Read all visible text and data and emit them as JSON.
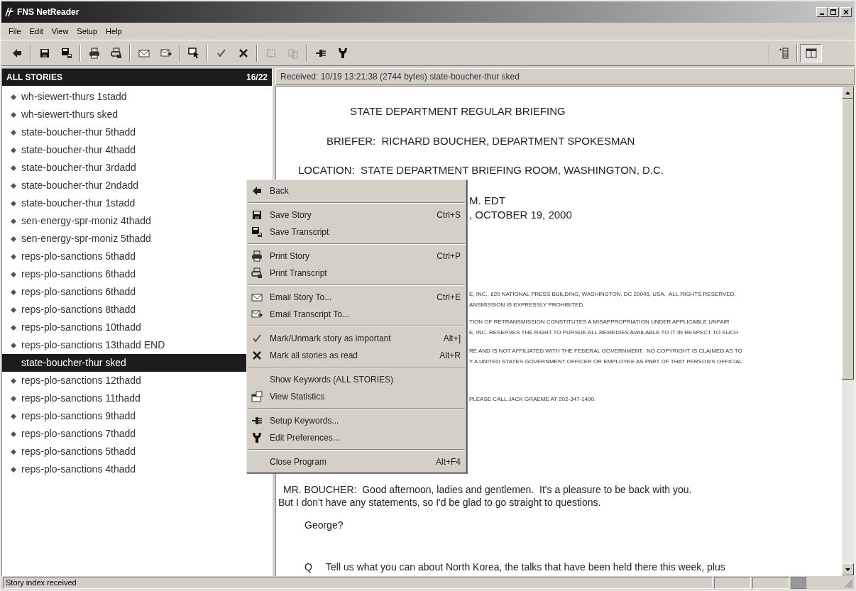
{
  "window": {
    "title": "FNS NetReader"
  },
  "menubar": [
    "File",
    "Edit",
    "View",
    "Setup",
    "Help"
  ],
  "toolbar": [
    {
      "kind": "back",
      "disabled": false
    },
    {
      "kind": "separator"
    },
    {
      "kind": "save",
      "disabled": false
    },
    {
      "kind": "save_transcript",
      "disabled": false
    },
    {
      "kind": "separator"
    },
    {
      "kind": "print",
      "disabled": false
    },
    {
      "kind": "print_transcript",
      "disabled": false
    },
    {
      "kind": "separator"
    },
    {
      "kind": "email",
      "disabled": false
    },
    {
      "kind": "email_transcript",
      "disabled": false
    },
    {
      "kind": "separator"
    },
    {
      "kind": "find",
      "disabled": false
    },
    {
      "kind": "separator"
    },
    {
      "kind": "check",
      "disabled": false
    },
    {
      "kind": "cross",
      "disabled": false
    },
    {
      "kind": "separator"
    },
    {
      "kind": "grid",
      "disabled": true
    },
    {
      "kind": "copy",
      "disabled": true
    },
    {
      "kind": "separator"
    },
    {
      "kind": "keywords",
      "disabled": false
    },
    {
      "kind": "wrench",
      "disabled": false
    }
  ],
  "toolbar_right": [
    {
      "kind": "list_add",
      "pressed": false
    },
    {
      "kind": "panes",
      "pressed": true
    }
  ],
  "stories": {
    "title": "ALL STORIES",
    "count": "16/22",
    "items": [
      {
        "label": "wh-siewert-thurs 1stadd",
        "selected": false
      },
      {
        "label": "wh-siewert-thurs sked",
        "selected": false
      },
      {
        "label": "state-boucher-thur 5thadd",
        "selected": false
      },
      {
        "label": "state-boucher-thur 4thadd",
        "selected": false
      },
      {
        "label": "state-boucher-thur 3rdadd",
        "selected": false
      },
      {
        "label": "state-boucher-thur 2ndadd",
        "selected": false
      },
      {
        "label": "state-boucher-thur 1stadd",
        "selected": false
      },
      {
        "label": "sen-energy-spr-moniz 4thadd",
        "selected": false
      },
      {
        "label": "sen-energy-spr-moniz 5thadd",
        "selected": false
      },
      {
        "label": "reps-plo-sanctions 5thadd",
        "selected": false
      },
      {
        "label": "reps-plo-sanctions 6thadd",
        "selected": false
      },
      {
        "label": "reps-plo-sanctions 6thadd",
        "selected": false
      },
      {
        "label": "reps-plo-sanctions 8thadd",
        "selected": false
      },
      {
        "label": "reps-plo-sanctions 10thadd",
        "selected": false
      },
      {
        "label": "reps-plo-sanctions 13thadd END",
        "selected": false
      },
      {
        "label": "state-boucher-thur sked",
        "selected": true
      },
      {
        "label": "reps-plo-sanctions 12thadd",
        "selected": false
      },
      {
        "label": "reps-plo-sanctions 11thadd",
        "selected": false
      },
      {
        "label": "reps-plo-sanctions 9thadd",
        "selected": false
      },
      {
        "label": "reps-plo-sanctions 7thadd",
        "selected": false
      },
      {
        "label": "reps-plo-sanctions 5thadd",
        "selected": false
      },
      {
        "label": "reps-plo-sanctions 4thadd",
        "selected": false
      }
    ]
  },
  "story": {
    "received": "Received: 10/19 13:21:38 (2744 bytes) state-boucher-thur sked",
    "lines": [
      {
        "kind": "heading",
        "text": "STATE DEPARTMENT REGULAR BRIEFING"
      },
      {
        "kind": "heading",
        "text": "BRIEFER:  RICHARD BOUCHER, DEPARTMENT SPOKESMAN"
      },
      {
        "kind": "heading",
        "text": "LOCATION:  STATE DEPARTMENT BRIEFING ROOM, WASHINGTON, D.C."
      },
      {
        "kind": "heading",
        "text": "M. EDT"
      },
      {
        "kind": "heading",
        "text": ", OCTOBER 19, 2000"
      },
      {
        "kind": "legal",
        "text": "E, INC., 620 NATIONAL PRESS BUILDING, WASHINGTON, DC 20045, USA.  ALL RIGHTS RESERVED."
      },
      {
        "kind": "legal",
        "text": "ANSMISSION IS EXPRESSLY PROHIBITED."
      },
      {
        "kind": "legal",
        "text": "TION OF RETRANSMISSION CONSTITUTES A MISAPPROPRIATION UNDER APPLICABLE UNFAIR"
      },
      {
        "kind": "legal",
        "text": "E, INC. RESERVES THE RIGHT TO PURSUE ALL REMEDIES AVAILABLE TO IT IN RESPECT TO SUCH"
      },
      {
        "kind": "legal",
        "text": "RE AND IS NOT AFFILIATED WITH THE FEDERAL GOVERNMENT.  NO COPYRIGHT IS CLAIMED AS TO"
      },
      {
        "kind": "legal",
        "text": "Y A UNITED STATES GOVERNMENT OFFICER OR EMPLOYEE AS PART OF THAT PERSON'S OFFICIAL"
      },
      {
        "kind": "legal",
        "text": "PLEASE CALL JACK GRAEME AT 202-347-1400."
      },
      {
        "kind": "para",
        "text": "MR. BOUCHER:  Good afternoon, ladies and gentlemen.  It's a pleasure to be back with you."
      },
      {
        "kind": "para",
        "text": "But I don't have any statements, so I'd be glad to go straight to questions."
      },
      {
        "kind": "para",
        "text": "George?"
      },
      {
        "kind": "para",
        "text": "Q     Tell us what you can about North Korea, the talks that have been held there this week, plus"
      }
    ]
  },
  "context_menu": [
    {
      "kind": "back",
      "label": "Back"
    },
    {
      "kind": "separator"
    },
    {
      "kind": "save",
      "label": "Save Story",
      "shortcut": "Ctrl+S"
    },
    {
      "kind": "save_transcript",
      "label": "Save Transcript"
    },
    {
      "kind": "separator"
    },
    {
      "kind": "print",
      "label": "Print Story",
      "shortcut": "Ctrl+P"
    },
    {
      "kind": "print_transcript",
      "label": "Print Transcript"
    },
    {
      "kind": "separator"
    },
    {
      "kind": "email",
      "label": "Email Story To...",
      "shortcut": "Ctrl+E"
    },
    {
      "kind": "email_transcript",
      "label": "Email Transcript To..."
    },
    {
      "kind": "separator"
    },
    {
      "kind": "check",
      "label": "Mark/Unmark story as important",
      "shortcut": "Alt+]"
    },
    {
      "kind": "cross",
      "label": "Mark all stories as read",
      "shortcut": "Alt+R"
    },
    {
      "kind": "separator"
    },
    {
      "kind": "plain",
      "label": "Show Keywords (ALL STORIES)"
    },
    {
      "kind": "stats",
      "label": "View Statistics"
    },
    {
      "kind": "separator"
    },
    {
      "kind": "keywords",
      "label": "Setup Keywords..."
    },
    {
      "kind": "wrench",
      "label": "Edit Preferences..."
    },
    {
      "kind": "separator"
    },
    {
      "kind": "plain",
      "label": "Close Program",
      "shortcut": "Alt+F4"
    }
  ],
  "status_bar": {
    "text": "Story index received"
  }
}
